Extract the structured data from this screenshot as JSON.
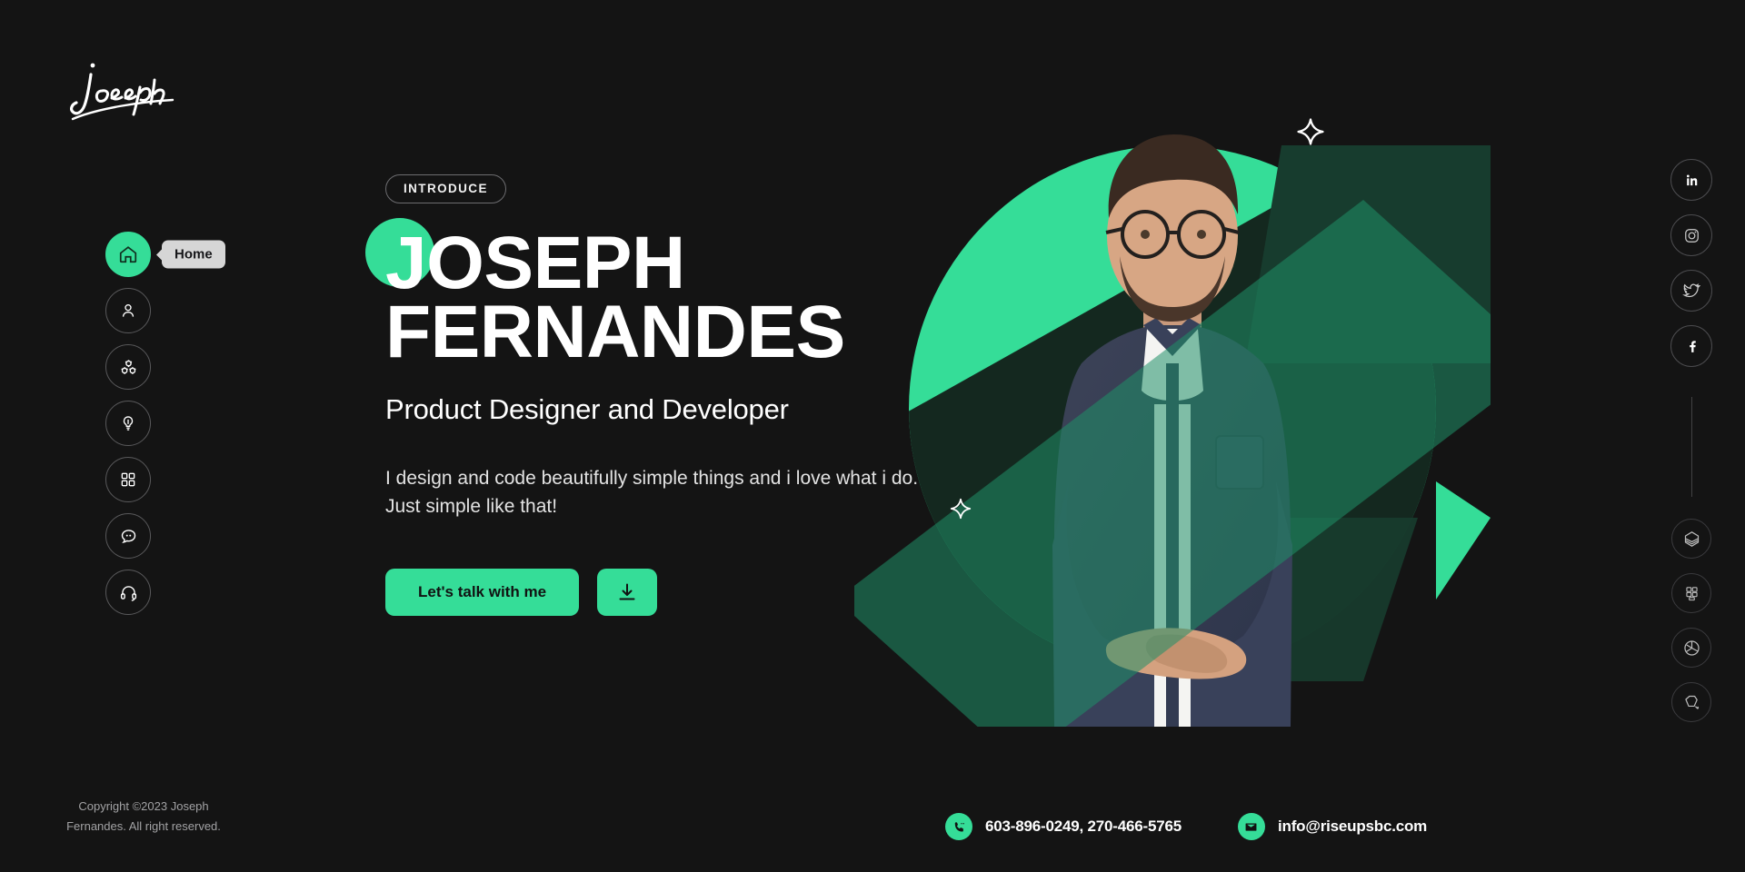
{
  "theme": {
    "background": "#141414",
    "accent": "#35DD98",
    "accent_dark": "#1d4a37",
    "text": "#ffffff",
    "muted": "#a2a2a4"
  },
  "logo": {
    "name": "Joseph",
    "alt": "Joseph signature logo"
  },
  "sidebar": {
    "tooltip": "Home",
    "items": [
      {
        "label": "Home",
        "icon": "home-icon",
        "active": true
      },
      {
        "label": "About",
        "icon": "user-icon",
        "active": false
      },
      {
        "label": "Services",
        "icon": "gears-icon",
        "active": false
      },
      {
        "label": "Skills",
        "icon": "idea-bulb-icon",
        "active": false
      },
      {
        "label": "Portfolio",
        "icon": "grid-icon",
        "active": false
      },
      {
        "label": "Testimonials",
        "icon": "chat-bubble-icon",
        "active": false
      },
      {
        "label": "Contact",
        "icon": "headphones-icon",
        "active": false
      }
    ]
  },
  "hero": {
    "badge": "INTRODUCE",
    "title_line1": "JOSEPH",
    "title_line2": "FERNANDES",
    "subtitle": "Product Designer and Developer",
    "description": "I design and code beautifully simple things and i love what i do. Just simple like that!",
    "primary_button": "Let's talk with me",
    "download_button_icon": "download-icon",
    "sparkle_icon": "sparkle-icon"
  },
  "social": [
    {
      "name": "LinkedIn",
      "icon": "linkedin-icon"
    },
    {
      "name": "Instagram",
      "icon": "instagram-icon"
    },
    {
      "name": "Twitter",
      "icon": "twitter-icon"
    },
    {
      "name": "Facebook",
      "icon": "facebook-icon"
    }
  ],
  "tools": [
    {
      "name": "Sketch",
      "icon": "sketch-icon"
    },
    {
      "name": "Figma",
      "icon": "figma-icon"
    },
    {
      "name": "Analytics",
      "icon": "pie-chart-icon"
    },
    {
      "name": "Photoshop",
      "icon": "pen-tool-icon"
    }
  ],
  "footer": {
    "copyright_line1": "Copyright ©2023 Joseph",
    "copyright_line2": "Fernandes. All right reserved.",
    "phone": "603-896-0249, 270-466-5765",
    "email": "info@riseupsbc.com",
    "phone_icon": "phone-icon",
    "email_icon": "mail-icon"
  }
}
